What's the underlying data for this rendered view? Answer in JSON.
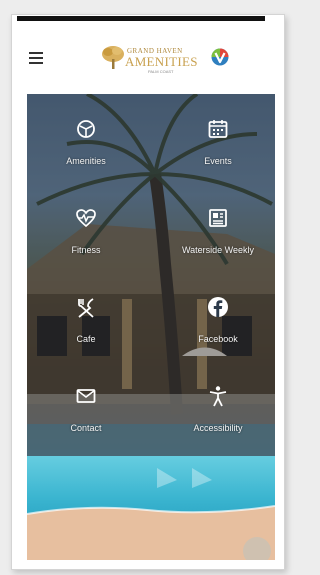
{
  "header": {
    "logo_line1": "GRAND HAVEN",
    "logo_line2": "AMENITIES",
    "logo_line3": "PALM COAST",
    "brand_color": "#c9a14f"
  },
  "tiles": [
    {
      "label": "Amenities",
      "icon": "amenities-icon"
    },
    {
      "label": "Events",
      "icon": "calendar-icon"
    },
    {
      "label": "Fitness",
      "icon": "heart-pulse-icon"
    },
    {
      "label": "Waterside Weekly",
      "icon": "newspaper-icon"
    },
    {
      "label": "Cafe",
      "icon": "fork-knife-icon"
    },
    {
      "label": "Facebook",
      "icon": "facebook-icon"
    },
    {
      "label": "Contact",
      "icon": "envelope-icon"
    },
    {
      "label": "Accessibility",
      "icon": "accessibility-icon"
    }
  ]
}
